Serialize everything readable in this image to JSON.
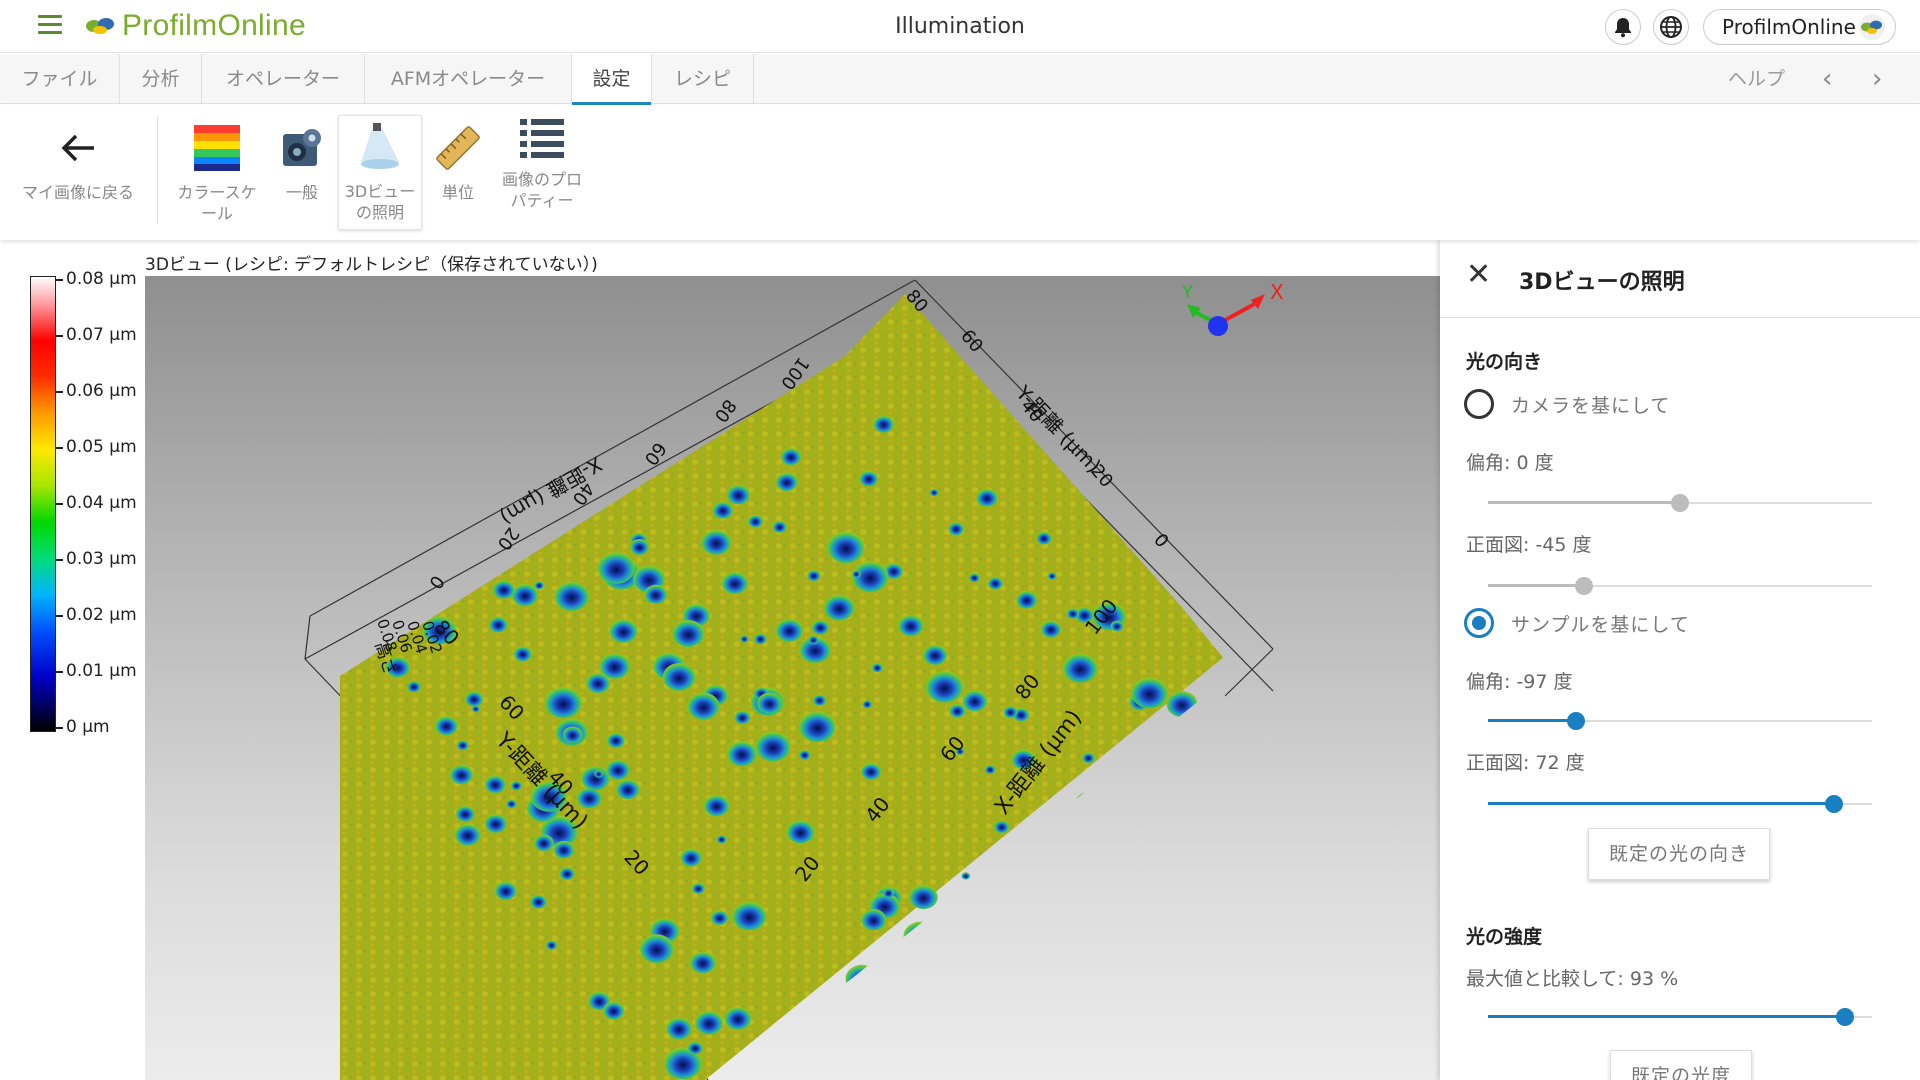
{
  "app": {
    "brand": "ProfilmOnline",
    "title": "Illumination",
    "user_label": "ProfilmOnline"
  },
  "tabs": [
    "ファイル",
    "分析",
    "オペレーター",
    "AFMオペレーター",
    "設定",
    "レシピ"
  ],
  "active_tab": "設定",
  "help_label": "ヘルプ",
  "ribbon": {
    "back": "マイ画像に戻る",
    "colorscale": "カラースケール",
    "general": "一般",
    "illumination": "3Dビューの照明",
    "units": "単位",
    "image_props": "画像のプロパティー"
  },
  "view": {
    "label": "3Dビュー (レシピ: デフォルトレシピ（保存されていない）)",
    "scale_labels": [
      "0.08 µm",
      "0.07 µm",
      "0.06 µm",
      "0.05 µm",
      "0.04 µm",
      "0.03 µm",
      "0.02 µm",
      "0.01 µm",
      "0 µm"
    ],
    "axis": {
      "x_label": "X-距離 (µm)",
      "y_label": "Y-距離 (µm)",
      "z_label": "高さ",
      "x_ticks": [
        "20",
        "40",
        "60",
        "80",
        "100"
      ],
      "y_ticks": [
        "20",
        "40",
        "60",
        "80"
      ],
      "z_ticks": [
        "0.08",
        "0.06",
        "0.04",
        "0.02"
      ],
      "back_x_label": "X-距離 (µm)",
      "back_y_label": "Y-距離 (µm)",
      "back_x_ticks": [
        "0",
        "20",
        "40",
        "60",
        "80",
        "100"
      ],
      "back_y_ticks": [
        "0",
        "20",
        "40",
        "60",
        "80"
      ],
      "gizmo_x": "X",
      "gizmo_y": "Y"
    }
  },
  "panel": {
    "title": "3Dビューの照明",
    "direction_heading": "光の向き",
    "camera_option": "カメラを基にして",
    "camera_azimuth": "偏角: 0 度",
    "camera_elevation": "正面図: -45 度",
    "sample_option": "サンプルを基にして",
    "sample_azimuth": "偏角: -97 度",
    "sample_elevation": "正面図: 72 度",
    "default_direction_button": "既定の光の向き",
    "intensity_heading": "光の強度",
    "intensity_label": "最大値と比較して: 93 %",
    "default_intensity_button": "既定の光度",
    "selected_option": "sample",
    "sliders": {
      "camera_azimuth": 0.5,
      "camera_elevation": 0.25,
      "sample_azimuth": 0.23,
      "sample_elevation": 0.9,
      "intensity": 0.93
    }
  },
  "colors": {
    "accent": "#1a7fc1",
    "brand": "#7aac2e"
  }
}
